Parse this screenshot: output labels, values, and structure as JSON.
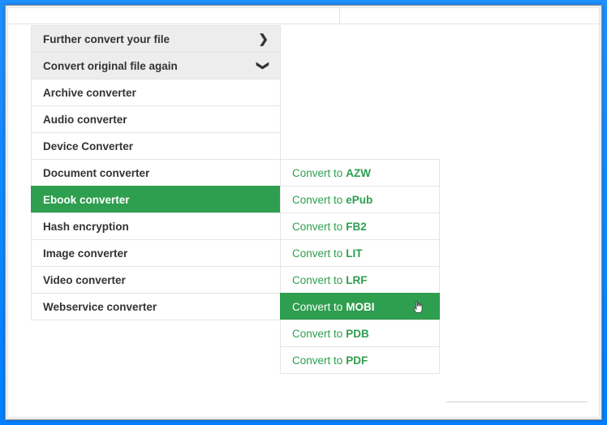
{
  "headers": {
    "further": "Further convert your file",
    "again": "Convert original file again"
  },
  "categories": {
    "archive": "Archive converter",
    "audio": "Audio converter",
    "device": "Device Converter",
    "document": "Document converter",
    "ebook": "Ebook converter",
    "hash": "Hash encryption",
    "image": "Image converter",
    "video": "Video converter",
    "webservice": "Webservice converter"
  },
  "sub": {
    "prefix": "Convert to",
    "azw": "AZW",
    "epub": "ePub",
    "fb2": "FB2",
    "lit": "LIT",
    "lrf": "LRF",
    "mobi": "MOBI",
    "pdb": "PDB",
    "pdf": "PDF"
  },
  "icons": {
    "chevron_right": "❯",
    "chevron_down": "❯",
    "hand_cursor": "☟"
  }
}
